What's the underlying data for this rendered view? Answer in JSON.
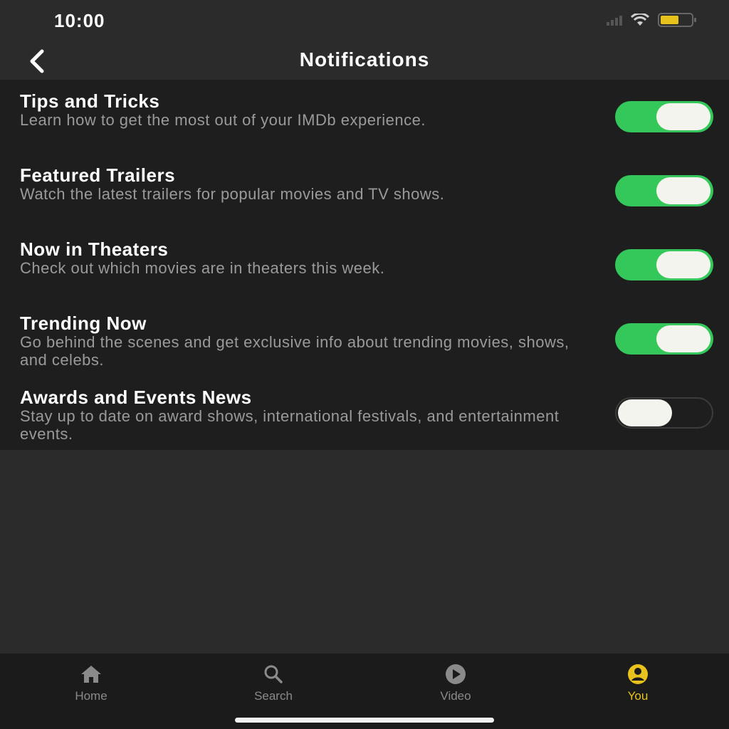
{
  "status_bar": {
    "time": "10:00"
  },
  "header": {
    "title": "Notifications",
    "back_icon": "chevron-left-icon"
  },
  "settings": [
    {
      "title": "Tips and Tricks",
      "description": "Learn how to get the most out of your IMDb experience.",
      "enabled": true
    },
    {
      "title": "Featured Trailers",
      "description": "Watch the latest trailers for popular movies and TV shows.",
      "enabled": true
    },
    {
      "title": "Now in Theaters",
      "description": "Check out which movies are in theaters this week.",
      "enabled": true
    },
    {
      "title": "Trending Now",
      "description": "Go behind the scenes and get exclusive info about trending movies, shows, and celebs.",
      "enabled": true
    },
    {
      "title": "Awards and Events News",
      "description": "Stay up to date on award shows, international festivals, and entertainment events.",
      "enabled": false
    }
  ],
  "tab_bar": {
    "tabs": [
      {
        "label": "Home",
        "icon": "home-icon",
        "active": false
      },
      {
        "label": "Search",
        "icon": "search-icon",
        "active": false
      },
      {
        "label": "Video",
        "icon": "play-icon",
        "active": false
      },
      {
        "label": "You",
        "icon": "profile-icon",
        "active": true
      }
    ]
  },
  "colors": {
    "toggle_on": "#34c759",
    "accent": "#e8c21c",
    "background": "#2b2b2b",
    "list_background": "#1e1e1e"
  }
}
